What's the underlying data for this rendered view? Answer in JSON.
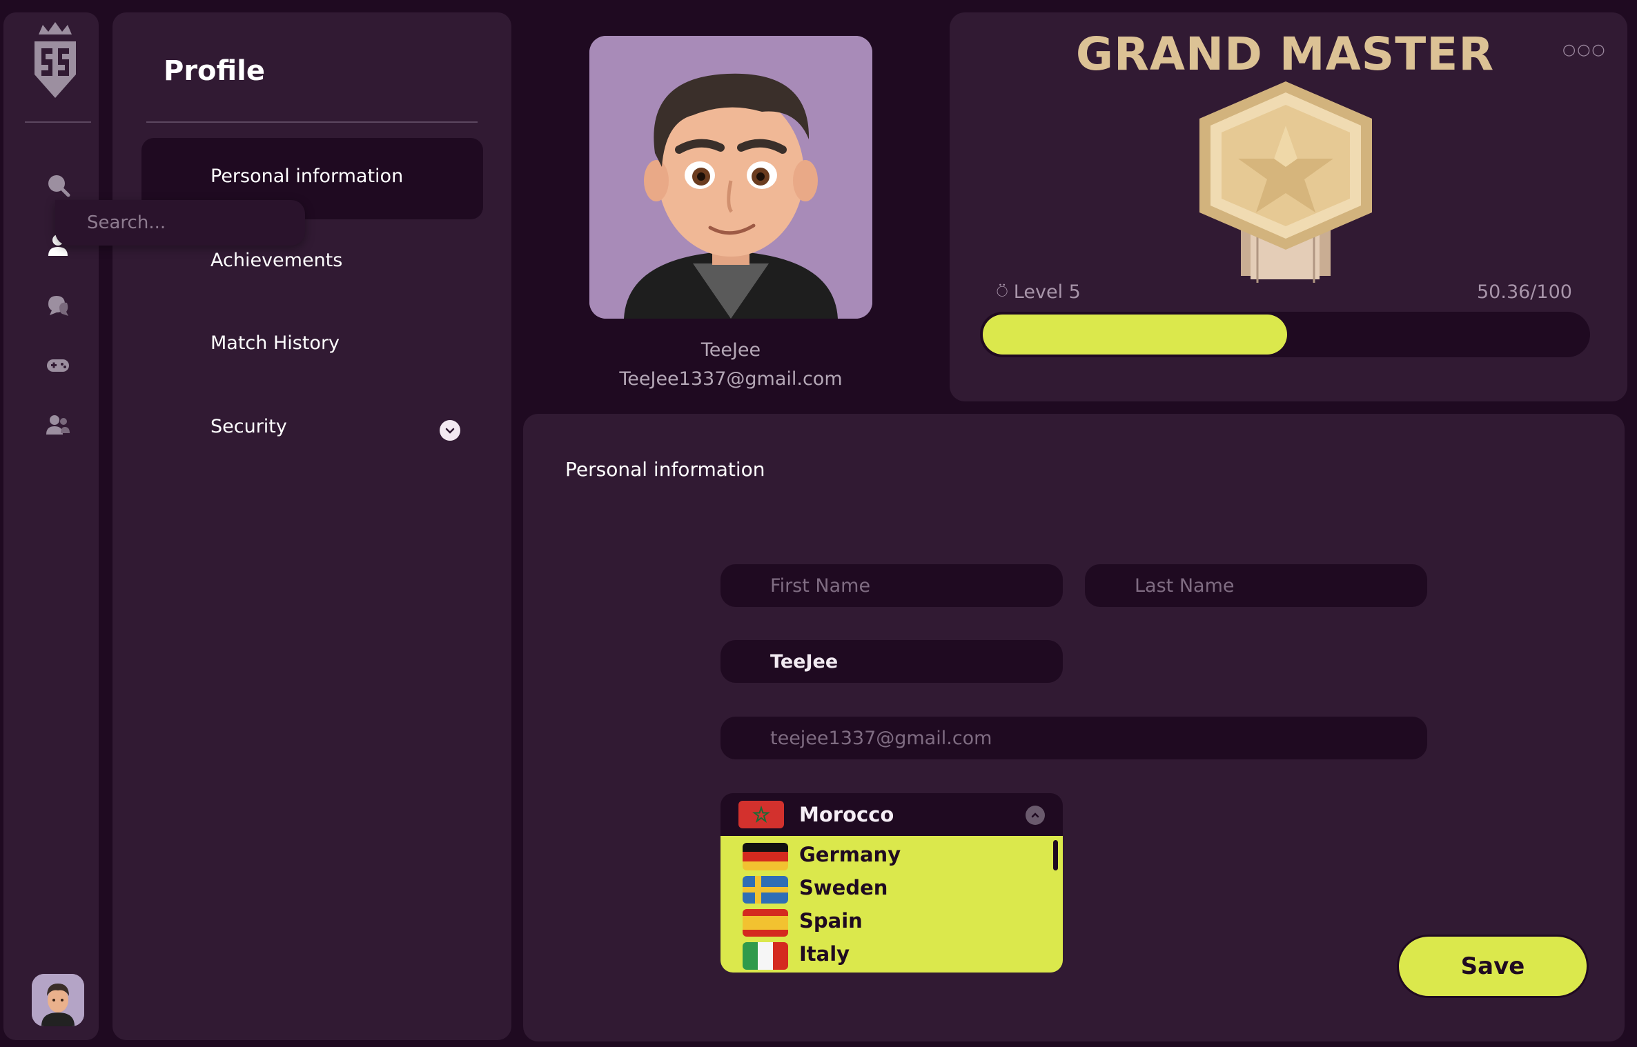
{
  "sidebar": {
    "icons": [
      "search-icon",
      "user-icon",
      "chat-icon",
      "gamepad-icon",
      "friends-icon"
    ]
  },
  "search": {
    "placeholder": "Search..."
  },
  "menu": {
    "title": "Profile",
    "items": [
      {
        "label": "Personal information",
        "active": true
      },
      {
        "label": "Achievements"
      },
      {
        "label": "Match History"
      },
      {
        "label": "Security",
        "icon": "chevron-down-icon"
      }
    ]
  },
  "user": {
    "name": "TeeJee",
    "email": "TeeJee1337@gmail.com"
  },
  "rank": {
    "title": "GRAND MASTER",
    "more_icon": "more-icon",
    "level_label": "Level 5",
    "score_label": "50.36/100",
    "progress": 0.5036,
    "progress_color": "#dbe84c"
  },
  "info": {
    "heading": "Personal information",
    "first_name_placeholder": "First Name",
    "last_name_placeholder": "Last Name",
    "nickname": "TeeJee",
    "email_value": "teejee1337@gmail.com",
    "country": {
      "selected": "Morocco",
      "options": [
        "Germany",
        "Sweden",
        "Spain",
        "Italy"
      ]
    },
    "save_label": "Save"
  },
  "colors": {
    "background": "#1f0a21",
    "panel": "#311a33",
    "accent": "#dbe84c",
    "gold": "#dcc295"
  }
}
